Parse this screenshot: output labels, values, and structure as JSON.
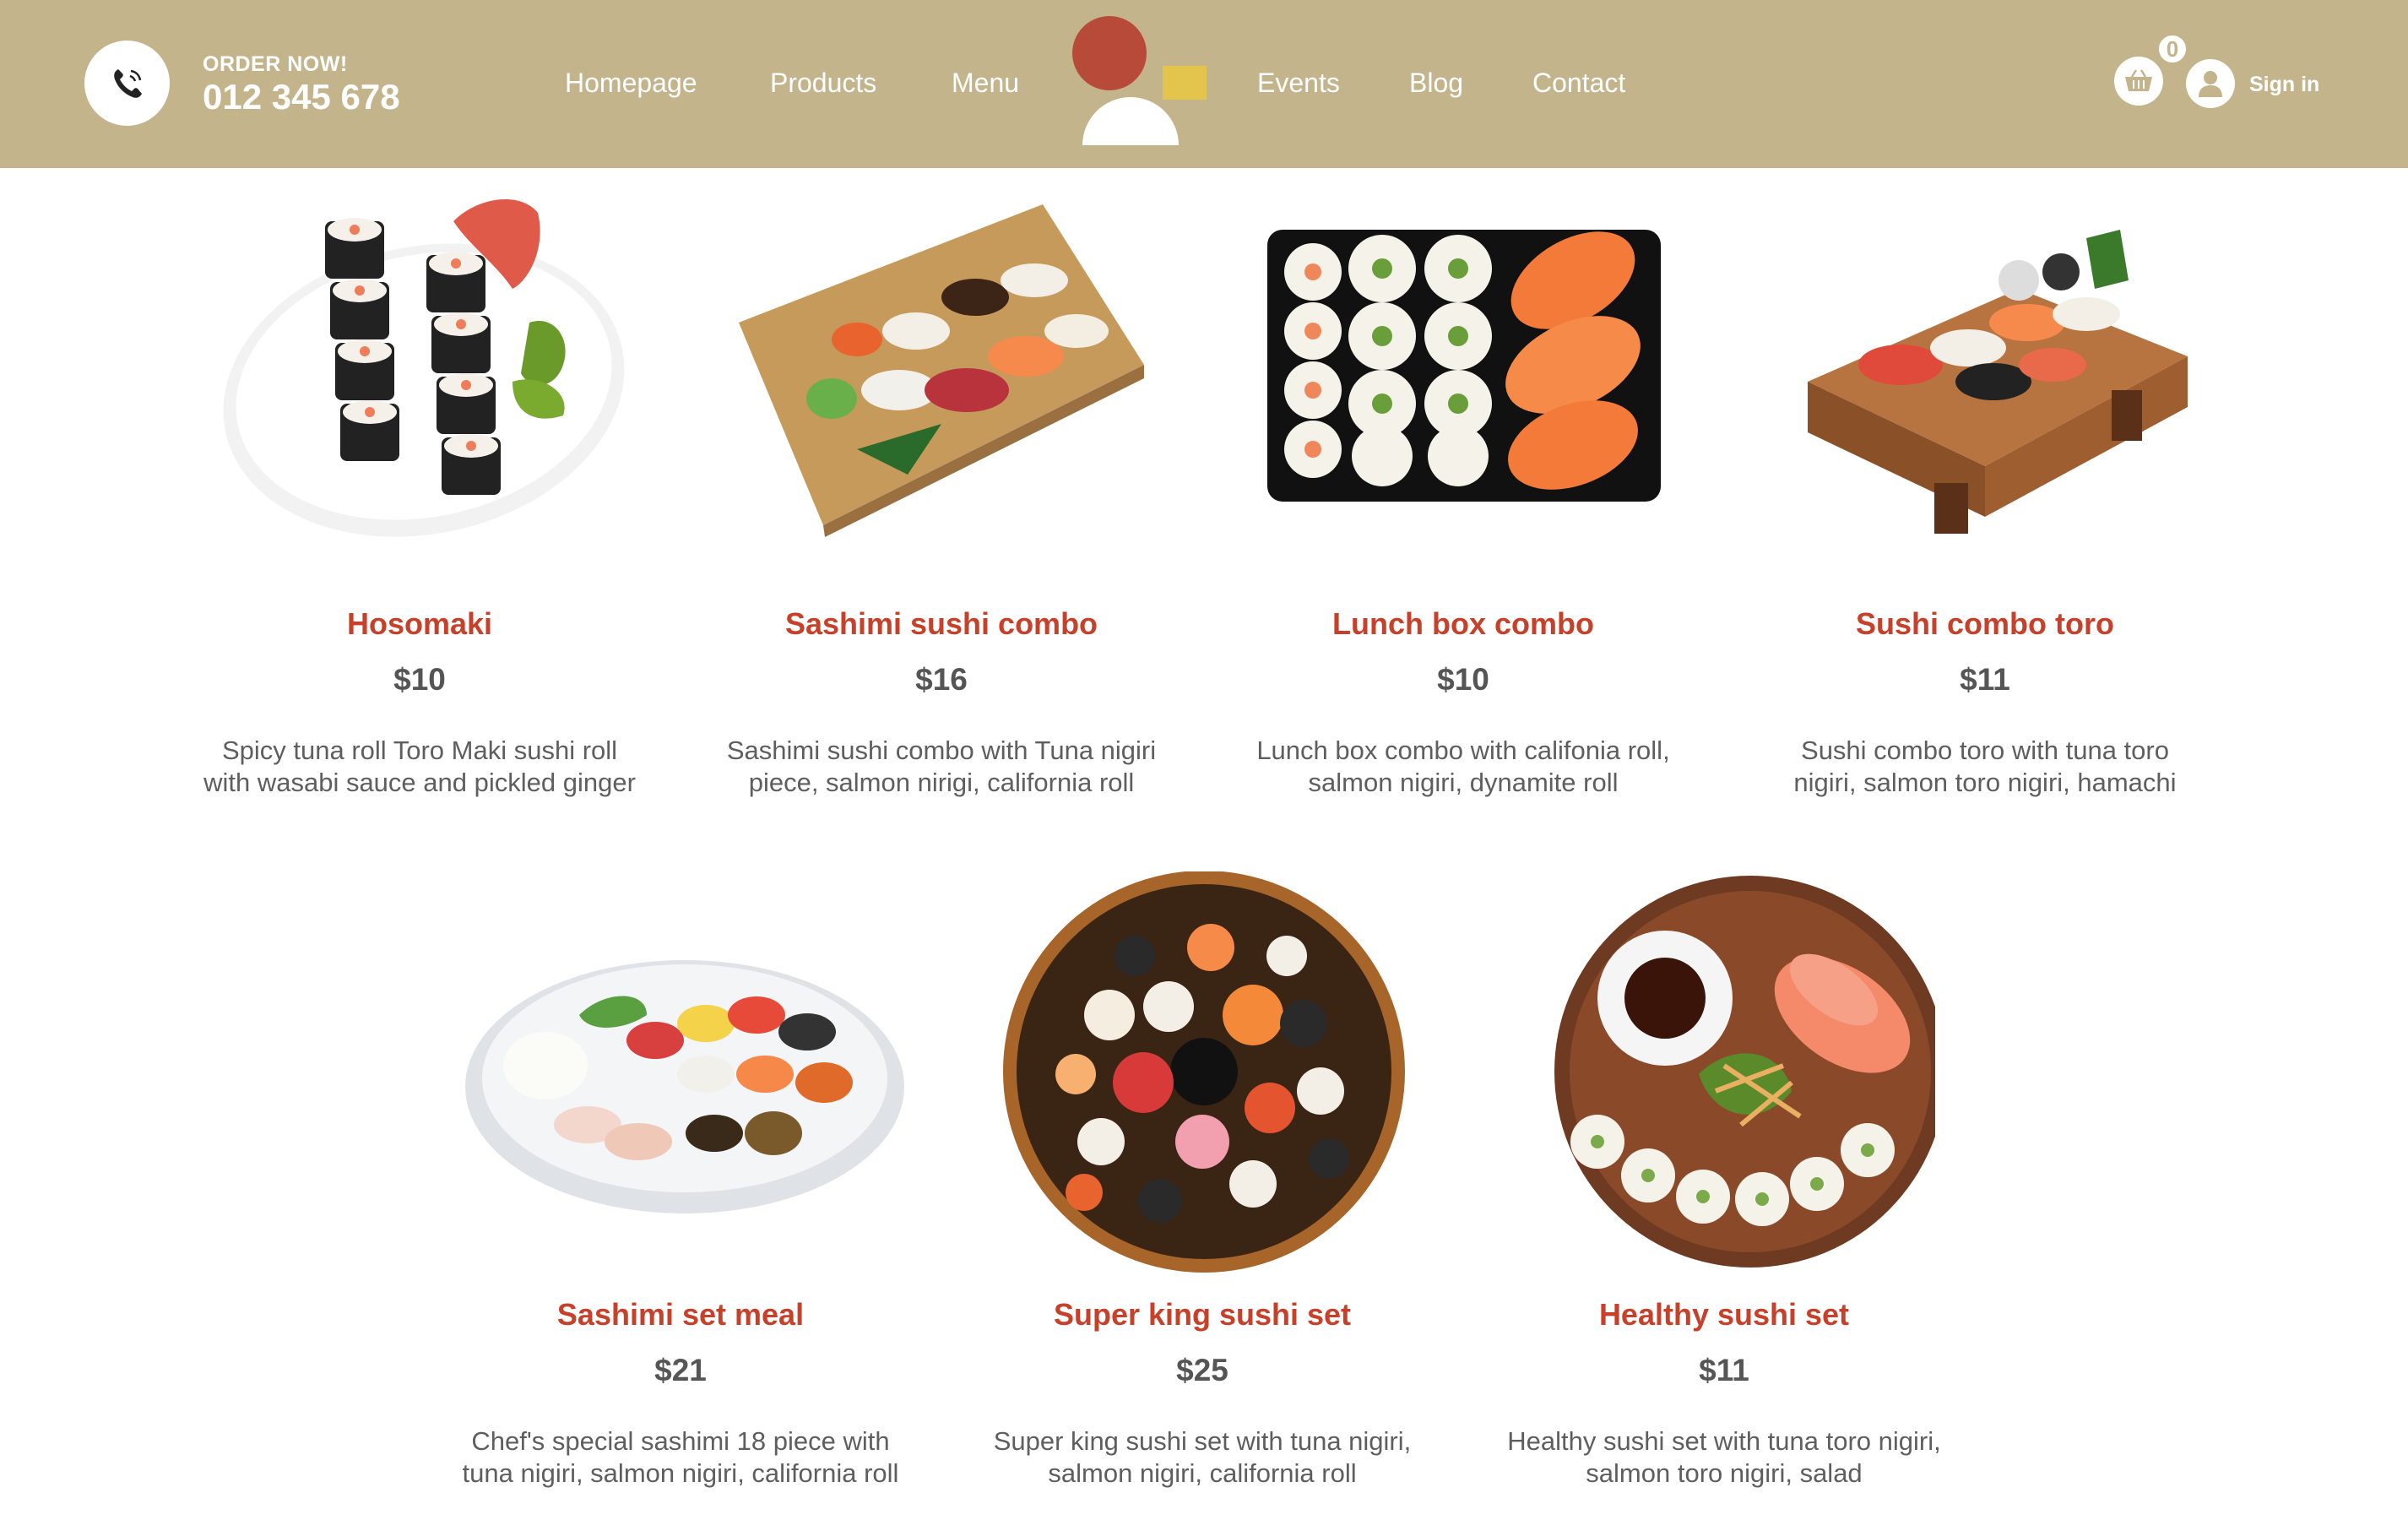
{
  "header": {
    "order_label": "ORDER NOW!",
    "order_number": "012 345 678",
    "nav": [
      "Homepage",
      "Products",
      "Menu",
      "Events",
      "Blog",
      "Contact"
    ],
    "cart_count": "0",
    "signin_label": "Sign in",
    "icons": [
      "phone-icon",
      "logo",
      "basket-icon",
      "user-icon"
    ]
  },
  "colors": {
    "header_bg": "#c4b48c",
    "accent_red": "#c6402a",
    "logo_yellow": "#e3c44c",
    "logo_red": "#b84a3a"
  },
  "products": [
    {
      "name": "Hosomaki",
      "price": "$10",
      "desc1": "Spicy tuna roll Toro Maki sushi roll",
      "desc2": "with wasabi sauce and pickled ginger"
    },
    {
      "name": "Sashimi sushi combo",
      "price": "$16",
      "desc1": "Sashimi sushi combo with Tuna nigiri",
      "desc2": "piece, salmon nirigi, california roll"
    },
    {
      "name": "Lunch box combo",
      "price": "$10",
      "desc1": "Lunch box combo with califonia roll,",
      "desc2": "salmon nigiri, dynamite roll"
    },
    {
      "name": "Sushi combo toro",
      "price": "$11",
      "desc1": "Sushi combo toro with tuna toro",
      "desc2": "nigiri, salmon toro nigiri, hamachi"
    },
    {
      "name": "Sashimi set meal",
      "price": "$21",
      "desc1": "Chef's special sashimi 18 piece with",
      "desc2": "tuna nigiri, salmon nigiri, california roll"
    },
    {
      "name": "Super king sushi set",
      "price": "$25",
      "desc1": "Super king sushi set with tuna nigiri,",
      "desc2": "salmon nigiri, california roll"
    },
    {
      "name": "Healthy sushi set",
      "price": "$11",
      "desc1": "Healthy sushi set with tuna toro nigiri,",
      "desc2": "salmon toro nigiri, salad"
    }
  ]
}
